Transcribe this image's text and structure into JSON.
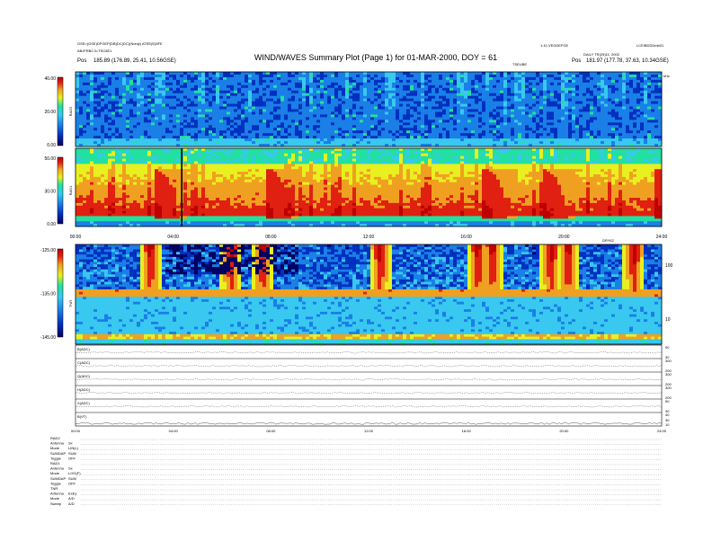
{
  "header": {
    "title": "WIND/WAVES Summary Plot (Page 1) for 01-MAR-2000, DOY = 61",
    "left_line1": "GSE>(GSE)DFGEP(DB)DC(DC)(Nonly) ATEE(E)8FE",
    "left_line2": "ABJFRB2.3=TSC8E1",
    "left_pos_label": "Pos",
    "left_pos_value": "185.89 (176.89, 25.41, 10.56GSE)",
    "right_line1": "1:10 VEGDEFGE",
    "right_line2": "DAILY TR(25)11, 2002",
    "right_pos_label": "Pos",
    "right_pos_value": "181.97 (177.78, 37.63, 10.34GSE)",
    "right_top": "LCEIBDDDmb01",
    "right_sub": "TSEUBE",
    "right_unit": "kHz"
  },
  "chart_data": [
    {
      "type": "heatmap",
      "panel": "RAD2",
      "ylabel": "RAD2",
      "yticks": [
        "40.00",
        "20.00",
        "0.00"
      ],
      "ylim": [
        0,
        40
      ],
      "x": [
        0,
        24
      ]
    },
    {
      "type": "heatmap",
      "panel": "RAD1",
      "ylabel": "RAD1",
      "yticks": [
        "50.00",
        "30.00",
        "0.00"
      ],
      "ylim": [
        0,
        50
      ],
      "x": [
        0,
        24
      ],
      "xticks": [
        "00:00",
        "04:00",
        "08:00",
        "12:00",
        "16:00",
        "20:00",
        "24:00"
      ],
      "xlabel_right": "DRY62",
      "cursor_x": 4.35,
      "bursts_hours": [
        3.1,
        7.7,
        16.6,
        19.0,
        23.7
      ]
    },
    {
      "type": "heatmap",
      "panel": "TNR",
      "ylabel": "TNR",
      "yticks": [
        "-125.00",
        "-135.00",
        "-145.00"
      ],
      "ylim": [
        -145,
        -125
      ],
      "right_yticks": [
        "100",
        "10"
      ],
      "x": [
        0,
        24
      ]
    },
    {
      "type": "line",
      "panel": "housekeeping",
      "x": [
        0,
        24
      ],
      "xticks": [
        "00:00",
        "04:00",
        "08:00",
        "12:00",
        "16:00",
        "20:00",
        "24:00"
      ],
      "series": [
        {
          "name": "B(ADC)",
          "right_ticks": [
            "90",
            "30"
          ]
        },
        {
          "name": "C(ADC)",
          "right_ticks": [
            "300",
            "200"
          ]
        },
        {
          "name": "Q(ADC)",
          "right_ticks": [
            "300",
            "200"
          ]
        },
        {
          "name": "H(ADC)",
          "right_ticks": [
            "300",
            "200"
          ]
        },
        {
          "name": "X(ADC)",
          "right_ticks": [
            "90",
            "30"
          ]
        },
        {
          "name": "B(VT)",
          "right_ticks": [
            "40",
            "30",
            "10"
          ]
        }
      ]
    }
  ],
  "footer": {
    "rows": [
      {
        "key": "RAD2",
        "val": ""
      },
      {
        "key": "Antenna",
        "val": "Sx"
      },
      {
        "key": "Mode",
        "val": "LIN(L)"
      },
      {
        "key": "SUMDAP",
        "val": "SUM"
      },
      {
        "key": "Toggle",
        "val": "OFF"
      },
      {
        "key": "RAD1",
        "val": ""
      },
      {
        "key": "Antenna",
        "val": "Sx"
      },
      {
        "key": "Mode",
        "val": "LOG(F)"
      },
      {
        "key": "SUMDAP",
        "val": "SUM"
      },
      {
        "key": "Toggle",
        "val": "OFF"
      },
      {
        "key": "TNR",
        "val": ""
      },
      {
        "key": "Antenna",
        "val": "ExEy"
      },
      {
        "key": "Mode",
        "val": "A/D"
      },
      {
        "key": "Sweep",
        "val": "A/D"
      }
    ]
  },
  "colors": {
    "scale": [
      "#000060",
      "#0030c0",
      "#1a7fe6",
      "#38c8f0",
      "#22e0a0",
      "#e8f020",
      "#f0a020",
      "#e02010",
      "#c00000"
    ],
    "trace": "#222222",
    "frame": "#000000"
  }
}
